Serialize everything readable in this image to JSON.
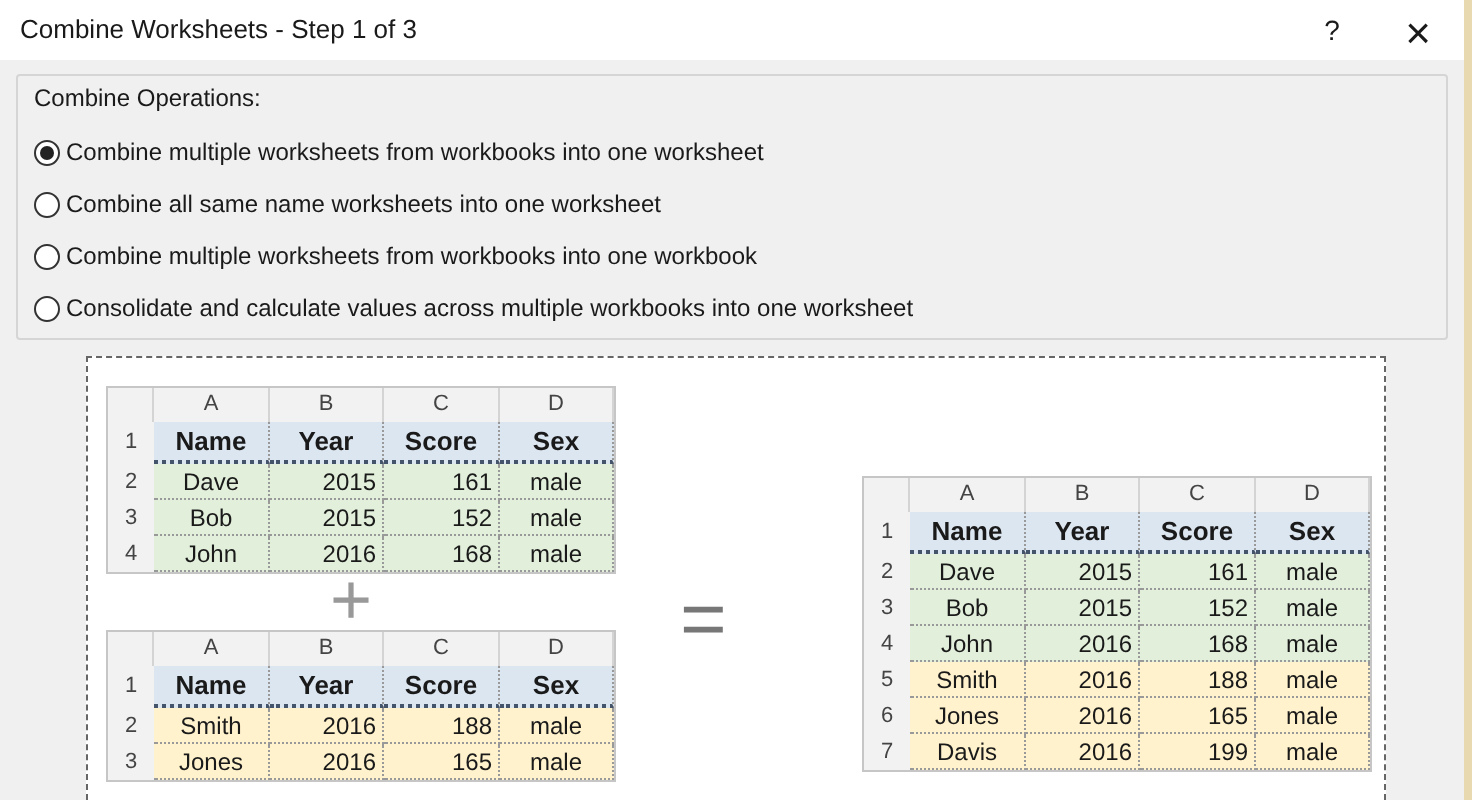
{
  "window": {
    "title": "Combine Worksheets - Step 1 of 3",
    "help": "?",
    "close": "×"
  },
  "group": {
    "title": "Combine Operations:",
    "options": [
      {
        "label": "Combine multiple worksheets from workbooks into one worksheet",
        "selected": true
      },
      {
        "label": "Combine all same name worksheets into one worksheet",
        "selected": false
      },
      {
        "label": "Combine multiple worksheets from workbooks into one workbook",
        "selected": false
      },
      {
        "label": "Consolidate and calculate values across multiple workbooks into one worksheet",
        "selected": false
      }
    ]
  },
  "illustration": {
    "operator_plus": "+",
    "operator_equals": "=",
    "tables": [
      {
        "columns": [
          "A",
          "B",
          "C",
          "D"
        ],
        "header_number": "1",
        "header": [
          "Name",
          "Year",
          "Score",
          "Sex"
        ],
        "rows": [
          {
            "number": "2",
            "cells": [
              "Dave",
              "2015",
              "161",
              "male"
            ],
            "color": "#e2efda"
          },
          {
            "number": "3",
            "cells": [
              "Bob",
              "2015",
              "152",
              "male"
            ],
            "color": "#e2efda"
          },
          {
            "number": "4",
            "cells": [
              "John",
              "2016",
              "168",
              "male"
            ],
            "color": "#e2efda"
          }
        ]
      },
      {
        "columns": [
          "A",
          "B",
          "C",
          "D"
        ],
        "header_number": "1",
        "header": [
          "Name",
          "Year",
          "Score",
          "Sex"
        ],
        "rows": [
          {
            "number": "2",
            "cells": [
              "Smith",
              "2016",
              "188",
              "male"
            ],
            "color": "#fff2cc"
          },
          {
            "number": "3",
            "cells": [
              "Jones",
              "2016",
              "165",
              "male"
            ],
            "color": "#fff2cc"
          }
        ]
      },
      {
        "columns": [
          "A",
          "B",
          "C",
          "D"
        ],
        "header_number": "1",
        "header": [
          "Name",
          "Year",
          "Score",
          "Sex"
        ],
        "rows": [
          {
            "number": "2",
            "cells": [
              "Dave",
              "2015",
              "161",
              "male"
            ],
            "color": "#e2efda"
          },
          {
            "number": "3",
            "cells": [
              "Bob",
              "2015",
              "152",
              "male"
            ],
            "color": "#e2efda"
          },
          {
            "number": "4",
            "cells": [
              "John",
              "2016",
              "168",
              "male"
            ],
            "color": "#e2efda"
          },
          {
            "number": "5",
            "cells": [
              "Smith",
              "2016",
              "188",
              "male"
            ],
            "color": "#fff2cc"
          },
          {
            "number": "6",
            "cells": [
              "Jones",
              "2016",
              "165",
              "male"
            ],
            "color": "#fff2cc"
          },
          {
            "number": "7",
            "cells": [
              "Davis",
              "2016",
              "199",
              "male"
            ],
            "color": "#fff2cc"
          }
        ]
      }
    ]
  }
}
